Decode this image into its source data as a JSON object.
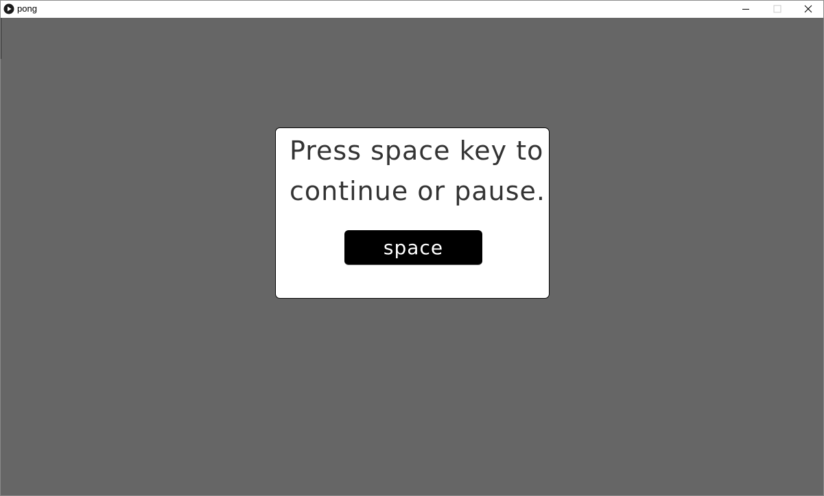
{
  "window": {
    "title": "pong",
    "icon": "play-circle-icon",
    "controls": {
      "minimize": "minimize-icon",
      "maximize": "maximize-icon",
      "close": "close-icon"
    }
  },
  "game": {
    "background_color": "#666666",
    "dialog": {
      "line_1": "Press space key to",
      "line_2": "continue or pause.",
      "key_label": "space"
    }
  }
}
